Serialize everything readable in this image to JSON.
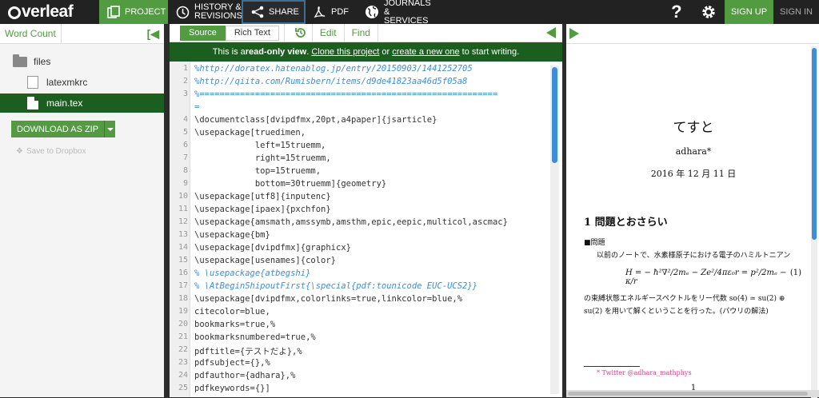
{
  "topbar": {
    "logo_text": "verleaf",
    "nav": [
      {
        "label": "PROJECT",
        "icon": "project-icon"
      },
      {
        "label": "HISTORY & REVISIONS",
        "icon": "history-icon"
      },
      {
        "label": "SHARE",
        "icon": "share-icon"
      },
      {
        "label": "PDF",
        "icon": "pdf-icon"
      },
      {
        "label": "JOURNALS & SERVICES",
        "icon": "globe-icon"
      }
    ],
    "help_icon": "question-icon",
    "settings_icon": "gear-icon",
    "signup": "SIGN UP",
    "signin": "SIGN IN"
  },
  "left": {
    "word_count": "Word Count",
    "files": [
      {
        "name": "files",
        "type": "folder"
      },
      {
        "name": "latexmkrc",
        "type": "file"
      },
      {
        "name": "main.tex",
        "type": "file",
        "selected": true
      }
    ],
    "download": "DOWNLOAD AS ZIP",
    "dropbox": "Save to Dropbox"
  },
  "editor": {
    "tab_source": "Source",
    "tab_rich": "Rich Text",
    "edit": "Edit",
    "find": "Find",
    "readonly_prefix": "This is a ",
    "readonly_bold": "read-only view",
    "readonly_mid1": ". ",
    "readonly_link1": "Clone this project",
    "readonly_mid2": " or ",
    "readonly_link2": "create a new one",
    "readonly_suffix": " to start writing.",
    "lines": [
      {
        "n": "1",
        "t": "%http://doratex.hatenablog.jp/entry/20150903/1441252705",
        "c": true
      },
      {
        "n": "2",
        "t": "%http://qiita.com/Rumisbern/items/d9de41823aa46d5f05a8",
        "c": true
      },
      {
        "n": "3",
        "t": "%===========================================================",
        "c": true
      },
      {
        "n": "",
        "t": "=",
        "c": true
      },
      {
        "n": "4",
        "t": "\\documentclass[dvipdfmx,20pt,a4paper]{jsarticle}",
        "c": false
      },
      {
        "n": "5",
        "t": "\\usepackage[truedimen,",
        "c": false
      },
      {
        "n": "6",
        "t": "            left=15truemm,",
        "c": false
      },
      {
        "n": "7",
        "t": "            right=15truemm,",
        "c": false
      },
      {
        "n": "8",
        "t": "            top=15truemm,",
        "c": false
      },
      {
        "n": "9",
        "t": "            bottom=30truemm]{geometry}",
        "c": false
      },
      {
        "n": "10",
        "t": "\\usepackage[utf8]{inputenc}",
        "c": false
      },
      {
        "n": "11",
        "t": "\\usepackage[ipaex]{pxchfon}",
        "c": false
      },
      {
        "n": "12",
        "t": "\\usepackage{amsmath,amssymb,amsthm,epic,eepic,multicol,ascmac}",
        "c": false
      },
      {
        "n": "13",
        "t": "\\usepackage{bm}",
        "c": false
      },
      {
        "n": "14",
        "t": "\\usepackage[dvipdfmx]{graphicx}",
        "c": false
      },
      {
        "n": "15",
        "t": "\\usepackage[usenames]{color}",
        "c": false
      },
      {
        "n": "16",
        "t": "% \\usepackage{atbegshi}",
        "c": true
      },
      {
        "n": "17",
        "t": "% \\AtBeginShipoutFirst{\\special{pdf:tounicode EUC-UCS2}}",
        "c": true
      },
      {
        "n": "18",
        "t": "\\usepackage[dvipdfmx,colorlinks=true,linkcolor=blue,%",
        "c": false
      },
      {
        "n": "19",
        "t": "citecolor=blue,",
        "c": false
      },
      {
        "n": "20",
        "t": "bookmarks=true,%",
        "c": false
      },
      {
        "n": "21",
        "t": "bookmarksnumbered=true,%",
        "c": false
      },
      {
        "n": "22",
        "t": "pdftitle={テストだよ},%",
        "c": false
      },
      {
        "n": "23",
        "t": "pdfsubject={},%",
        "c": false
      },
      {
        "n": "24",
        "t": "pdfauthor={adhara},%",
        "c": false
      },
      {
        "n": "25",
        "t": "pdfkeywords={}]",
        "c": false
      }
    ]
  },
  "preview": {
    "title": "てすと",
    "author": "adhara*",
    "date": "2016 年 12 月 11 日",
    "section": "1   問題とおさらい",
    "subsection": "■問題",
    "para1": "以前のノートで、水素様原子における電子のハミルトニアン",
    "eq_lhs": "H = − ħ²∇²/2mₑ − Ze²/4πε₀r = p²/2mₑ − κ/r",
    "eq_num": "(1)",
    "para2a": "の束縛状態エネルギースペクトルをリー代数 so(4) ≃ su(2) ⊕",
    "para2b": "su(2) を用いて解くということを行った。(パウリの解法)",
    "footnote": "* Twitter @adhara_mathphys",
    "page_number": "1"
  }
}
